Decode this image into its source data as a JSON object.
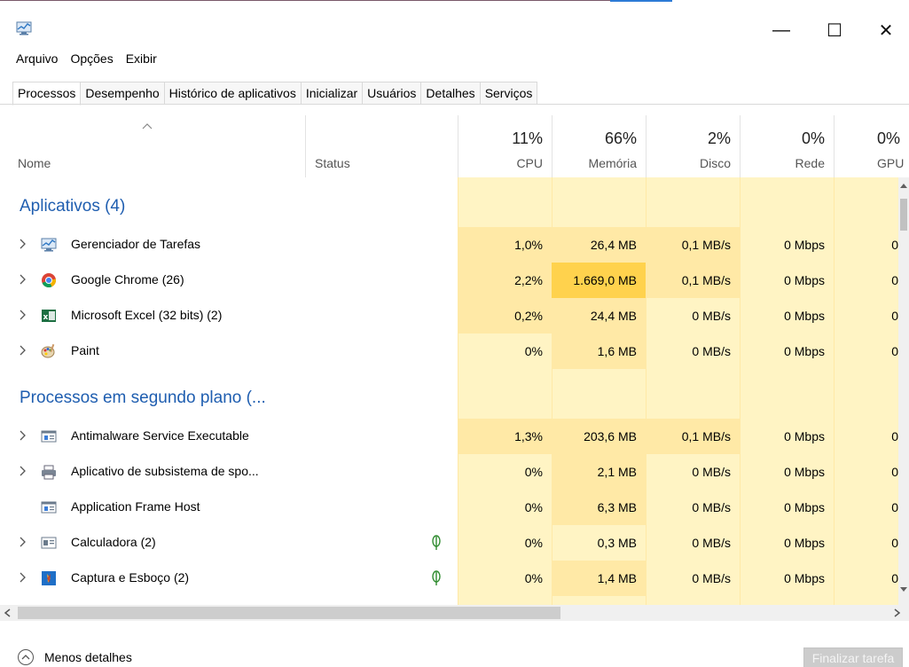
{
  "window": {
    "minimize_glyph": "—",
    "maximize_glyph": "☐",
    "close_glyph": "✕"
  },
  "menu": [
    "Arquivo",
    "Opções",
    "Exibir"
  ],
  "tabs": [
    "Processos",
    "Desempenho",
    "Histórico de aplicativos",
    "Inicializar",
    "Usuários",
    "Detalhes",
    "Serviços"
  ],
  "header": {
    "name": "Nome",
    "status": "Status",
    "cpu_pct": "11%",
    "cpu": "CPU",
    "mem_pct": "66%",
    "mem": "Memória",
    "disk_pct": "2%",
    "disk": "Disco",
    "net_pct": "0%",
    "net": "Rede",
    "gpu_pct": "0%",
    "gpu": "GPU"
  },
  "groups": {
    "apps": "Aplicativos (4)",
    "background": "Processos em segundo plano (..."
  },
  "apps": [
    {
      "name": "Gerenciador de Tarefas",
      "icon": "task-manager-icon",
      "cpu": "1,0%",
      "mem": "26,4 MB",
      "disk": "0,1 MB/s",
      "net": "0 Mbps",
      "gpu": "0"
    },
    {
      "name": "Google Chrome (26)",
      "icon": "chrome-icon",
      "cpu": "2,2%",
      "mem": "1.669,0 MB",
      "disk": "0,1 MB/s",
      "net": "0 Mbps",
      "gpu": "0"
    },
    {
      "name": "Microsoft Excel (32 bits) (2)",
      "icon": "excel-icon",
      "cpu": "0,2%",
      "mem": "24,4 MB",
      "disk": "0 MB/s",
      "net": "0 Mbps",
      "gpu": "0"
    },
    {
      "name": "Paint",
      "icon": "paint-icon",
      "cpu": "0%",
      "mem": "1,6 MB",
      "disk": "0 MB/s",
      "net": "0 Mbps",
      "gpu": "0"
    }
  ],
  "background": [
    {
      "name": "Antimalware Service Executable",
      "icon": "service-icon",
      "cpu": "1,3%",
      "mem": "203,6 MB",
      "disk": "0,1 MB/s",
      "net": "0 Mbps",
      "gpu": "0"
    },
    {
      "name": "Aplicativo de subsistema de spo...",
      "icon": "printer-icon",
      "cpu": "0%",
      "mem": "2,1 MB",
      "disk": "0 MB/s",
      "net": "0 Mbps",
      "gpu": "0"
    },
    {
      "name": "Application Frame Host",
      "icon": "service-icon",
      "cpu": "0%",
      "mem": "6,3 MB",
      "disk": "0 MB/s",
      "net": "0 Mbps",
      "gpu": "0"
    },
    {
      "name": "Calculadora (2)",
      "icon": "calculator-icon",
      "cpu": "0%",
      "mem": "0,3 MB",
      "disk": "0 MB/s",
      "net": "0 Mbps",
      "gpu": "0"
    },
    {
      "name": "Captura e Esboço (2)",
      "icon": "snip-sketch-icon",
      "cpu": "0%",
      "mem": "1,4 MB",
      "disk": "0 MB/s",
      "net": "0 Mbps",
      "gpu": "0"
    }
  ],
  "footer": {
    "less_details": "Menos detalhes",
    "end_task": "Finalizar tarefa"
  },
  "colors": {
    "heat_light": "#fff4c4",
    "heat_mid": "#ffe9a6",
    "heat_high": "#ffd24d",
    "group_title": "#1f5eb0"
  }
}
